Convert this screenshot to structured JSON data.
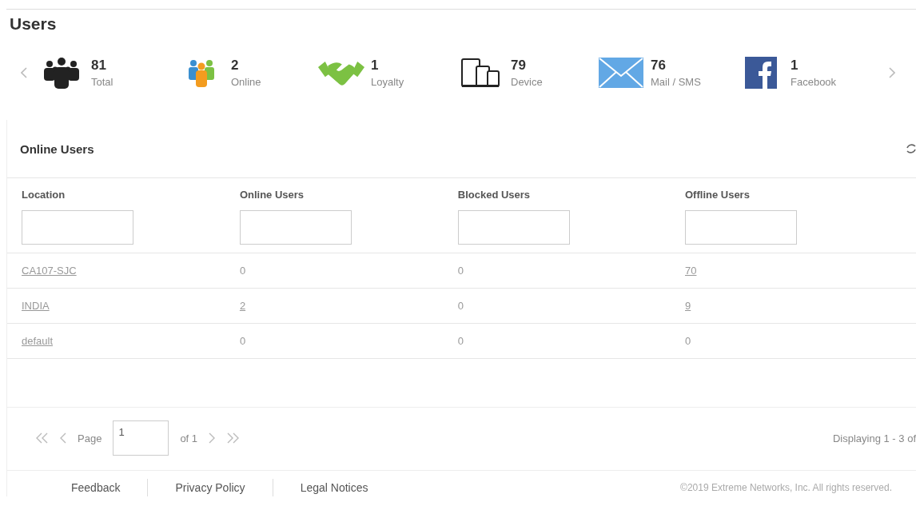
{
  "title": "Users",
  "stats": [
    {
      "kind": "people",
      "count": "81",
      "label": "Total"
    },
    {
      "kind": "online",
      "count": "2",
      "label": "Online"
    },
    {
      "kind": "handshake",
      "count": "1",
      "label": "Loyalty"
    },
    {
      "kind": "device",
      "count": "79",
      "label": "Device"
    },
    {
      "kind": "mail",
      "count": "76",
      "label": "Mail / SMS"
    },
    {
      "kind": "facebook",
      "count": "1",
      "label": "Facebook"
    }
  ],
  "panel": {
    "title": "Online Users",
    "columns": [
      "Location",
      "Online Users",
      "Blocked Users",
      "Offline Users"
    ],
    "rows": [
      [
        {
          "text": "CA107-SJC",
          "kind": "link"
        },
        {
          "text": "0",
          "kind": "text"
        },
        {
          "text": "0",
          "kind": "text"
        },
        {
          "text": "70",
          "kind": "link"
        }
      ],
      [
        {
          "text": "INDIA",
          "kind": "link"
        },
        {
          "text": "2",
          "kind": "link"
        },
        {
          "text": "0",
          "kind": "text"
        },
        {
          "text": "9",
          "kind": "link"
        }
      ],
      [
        {
          "text": "default",
          "kind": "link"
        },
        {
          "text": "0",
          "kind": "text"
        },
        {
          "text": "0",
          "kind": "text"
        },
        {
          "text": "0",
          "kind": "text"
        }
      ]
    ],
    "pager": {
      "page_label": "Page",
      "page": "1",
      "of": "of 1",
      "display": "Displaying 1 - 3 of"
    }
  },
  "footer": {
    "links": [
      "Feedback",
      "Privacy Policy",
      "Legal Notices"
    ],
    "copyright": "©2019 Extreme Networks, Inc. All rights reserved."
  }
}
